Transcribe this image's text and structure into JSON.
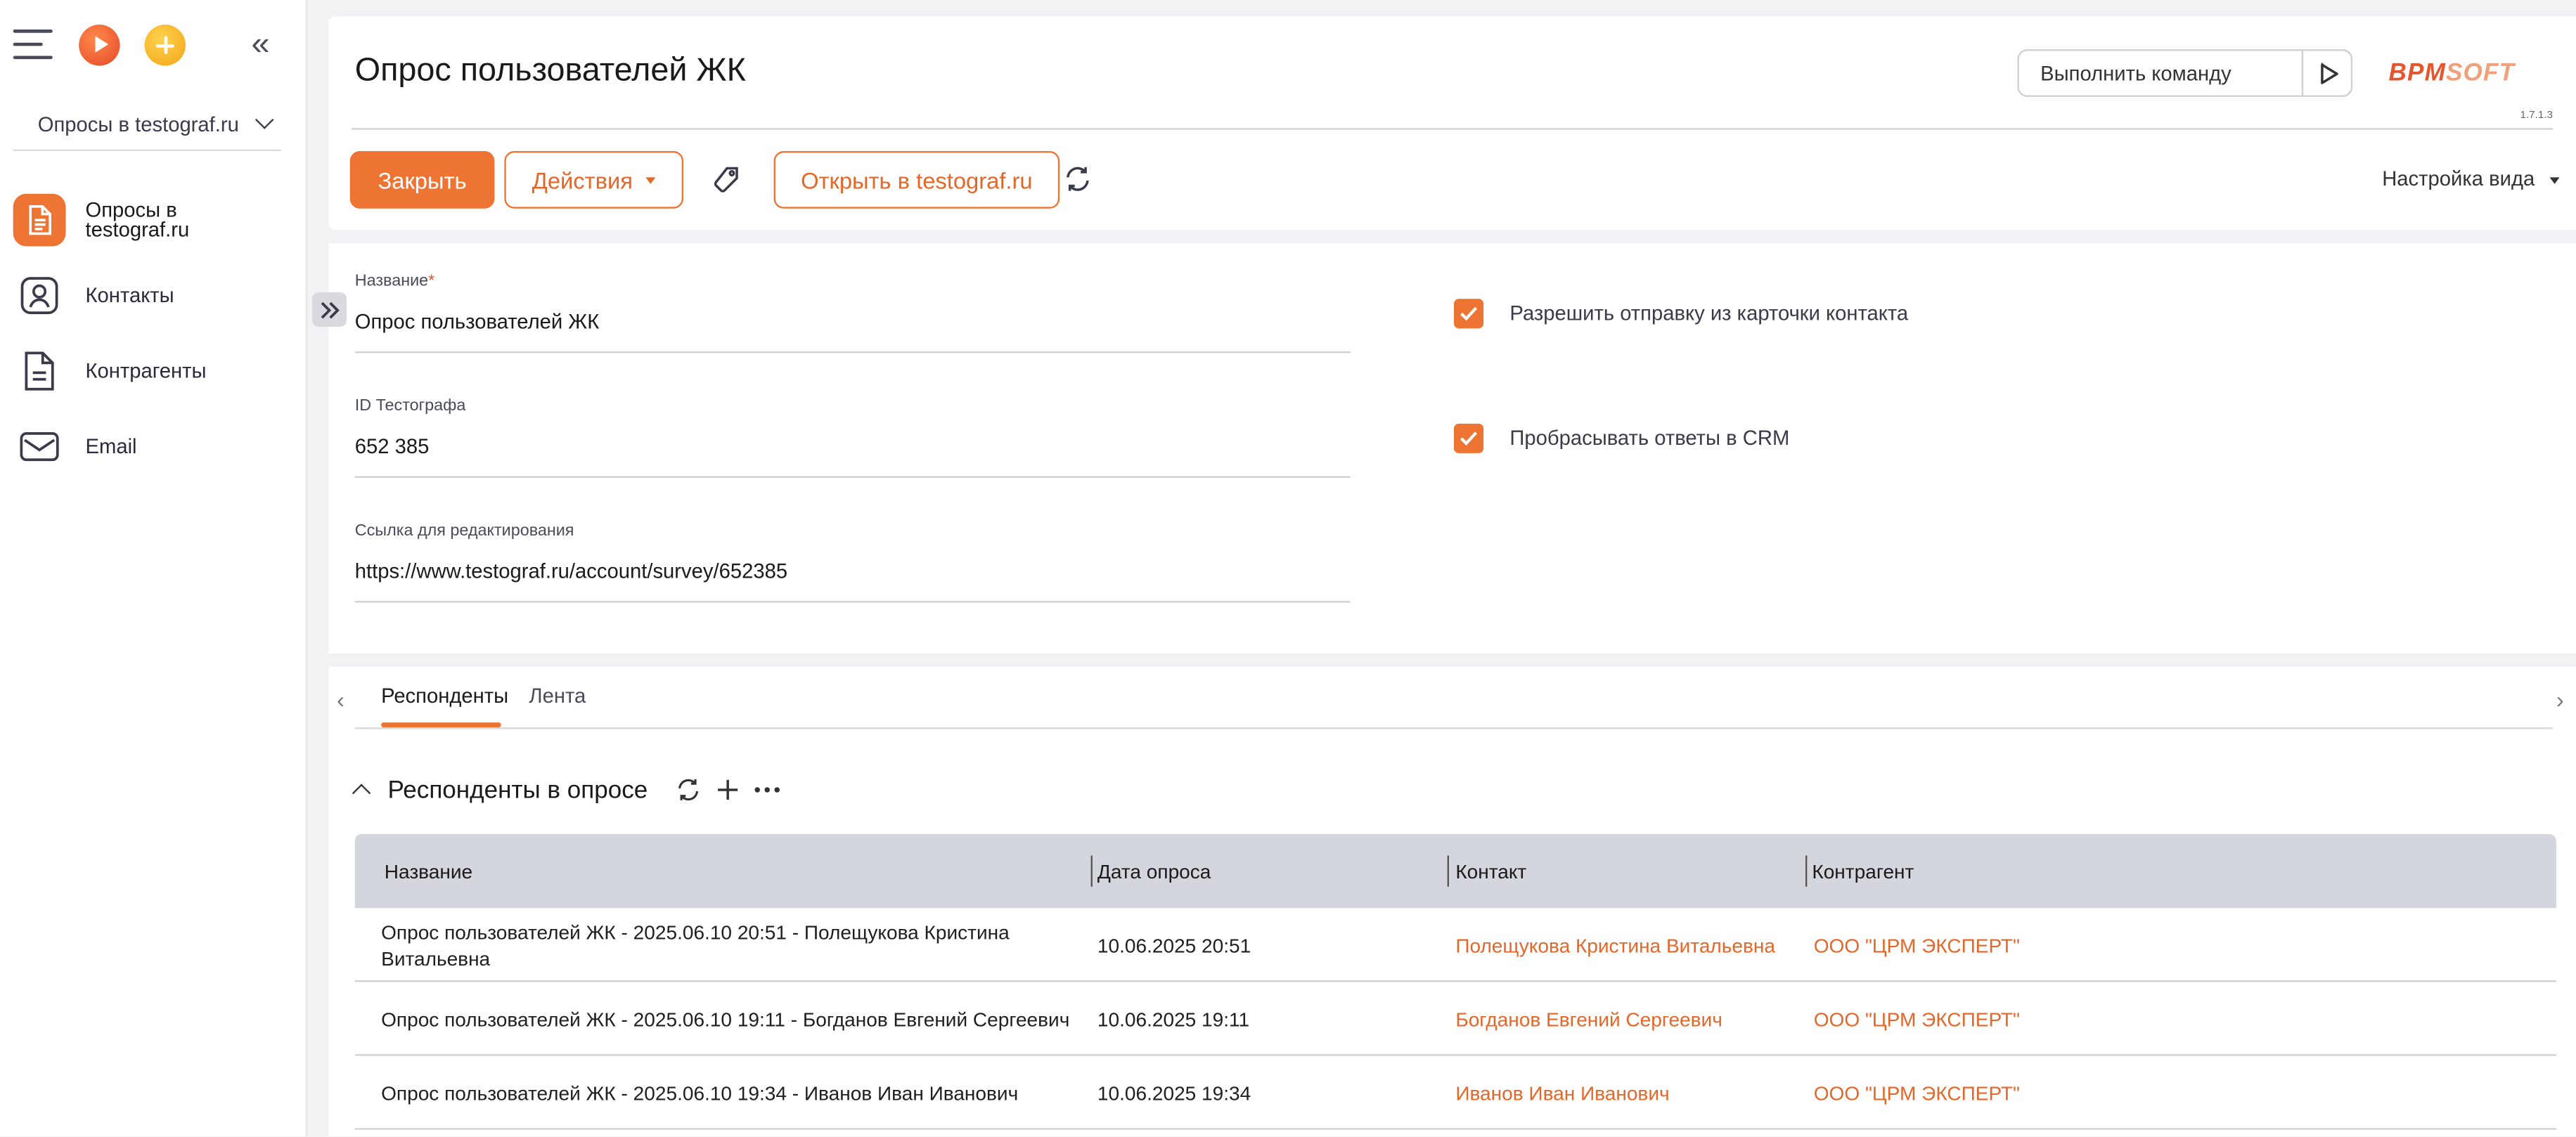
{
  "sidebar": {
    "section_select": "Опросы в testograf.ru",
    "items": [
      {
        "label_line1": "Опросы в",
        "label_line2": "testograf.ru",
        "active": true
      },
      {
        "label": "Контакты"
      },
      {
        "label": "Контрагенты"
      },
      {
        "label": "Email"
      }
    ]
  },
  "header": {
    "title": "Опрос пользователей ЖК",
    "command_placeholder": "Выполнить команду",
    "logo_part1": "BPM",
    "logo_part2": "SOFT",
    "version": "1.7.1.3",
    "buttons": {
      "close": "Закрыть",
      "actions": "Действия",
      "open": "Открыть в testograf.ru"
    },
    "view_settings": "Настройка вида"
  },
  "form": {
    "name_label": "Название",
    "name_required_mark": "*",
    "name_value": "Опрос пользователей ЖК",
    "id_label": "ID Тестографа",
    "id_value": "652 385",
    "link_label": "Ссылка для редактирования",
    "link_value": "https://www.testograf.ru/account/survey/652385",
    "allow_send_label": "Разрешить отправку из карточки контакта",
    "allow_send_checked": true,
    "forward_answers_label": "Пробрасывать ответы в CRM",
    "forward_answers_checked": true
  },
  "tabs": {
    "items": [
      "Респонденты",
      "Лента"
    ],
    "active": 0
  },
  "detail": {
    "title": "Респонденты в опросе",
    "columns": [
      "Название",
      "Дата опроса",
      "Контакт",
      "Контрагент"
    ],
    "rows": [
      {
        "name_line1": "Опрос пользователей ЖК - 2025.06.10 20:51 - Полещукова Кристина",
        "name_line2": "Витальевна",
        "date": "10.06.2025 20:51",
        "contact": "Полещукова Кристина Витальевна",
        "account": "ООО \"ЦРМ ЭКСПЕРТ\""
      },
      {
        "name_line1": "Опрос пользователей ЖК - 2025.06.10 19:11 - Богданов Евгений Сергеевич",
        "name_line2": "",
        "date": "10.06.2025 19:11",
        "contact": "Богданов Евгений Сергеевич",
        "account": "ООО \"ЦРМ ЭКСПЕРТ\""
      },
      {
        "name_line1": "Опрос пользователей ЖК - 2025.06.10 19:34 - Иванов Иван Иванович",
        "name_line2": "",
        "date": "10.06.2025 19:34",
        "contact": "Иванов Иван Иванович",
        "account": "ООО \"ЦРМ ЭКСПЕРТ\""
      }
    ]
  },
  "colors": {
    "accent": "#ee7434",
    "link": "#e4672a",
    "grid_header": "#d3d6dd"
  }
}
